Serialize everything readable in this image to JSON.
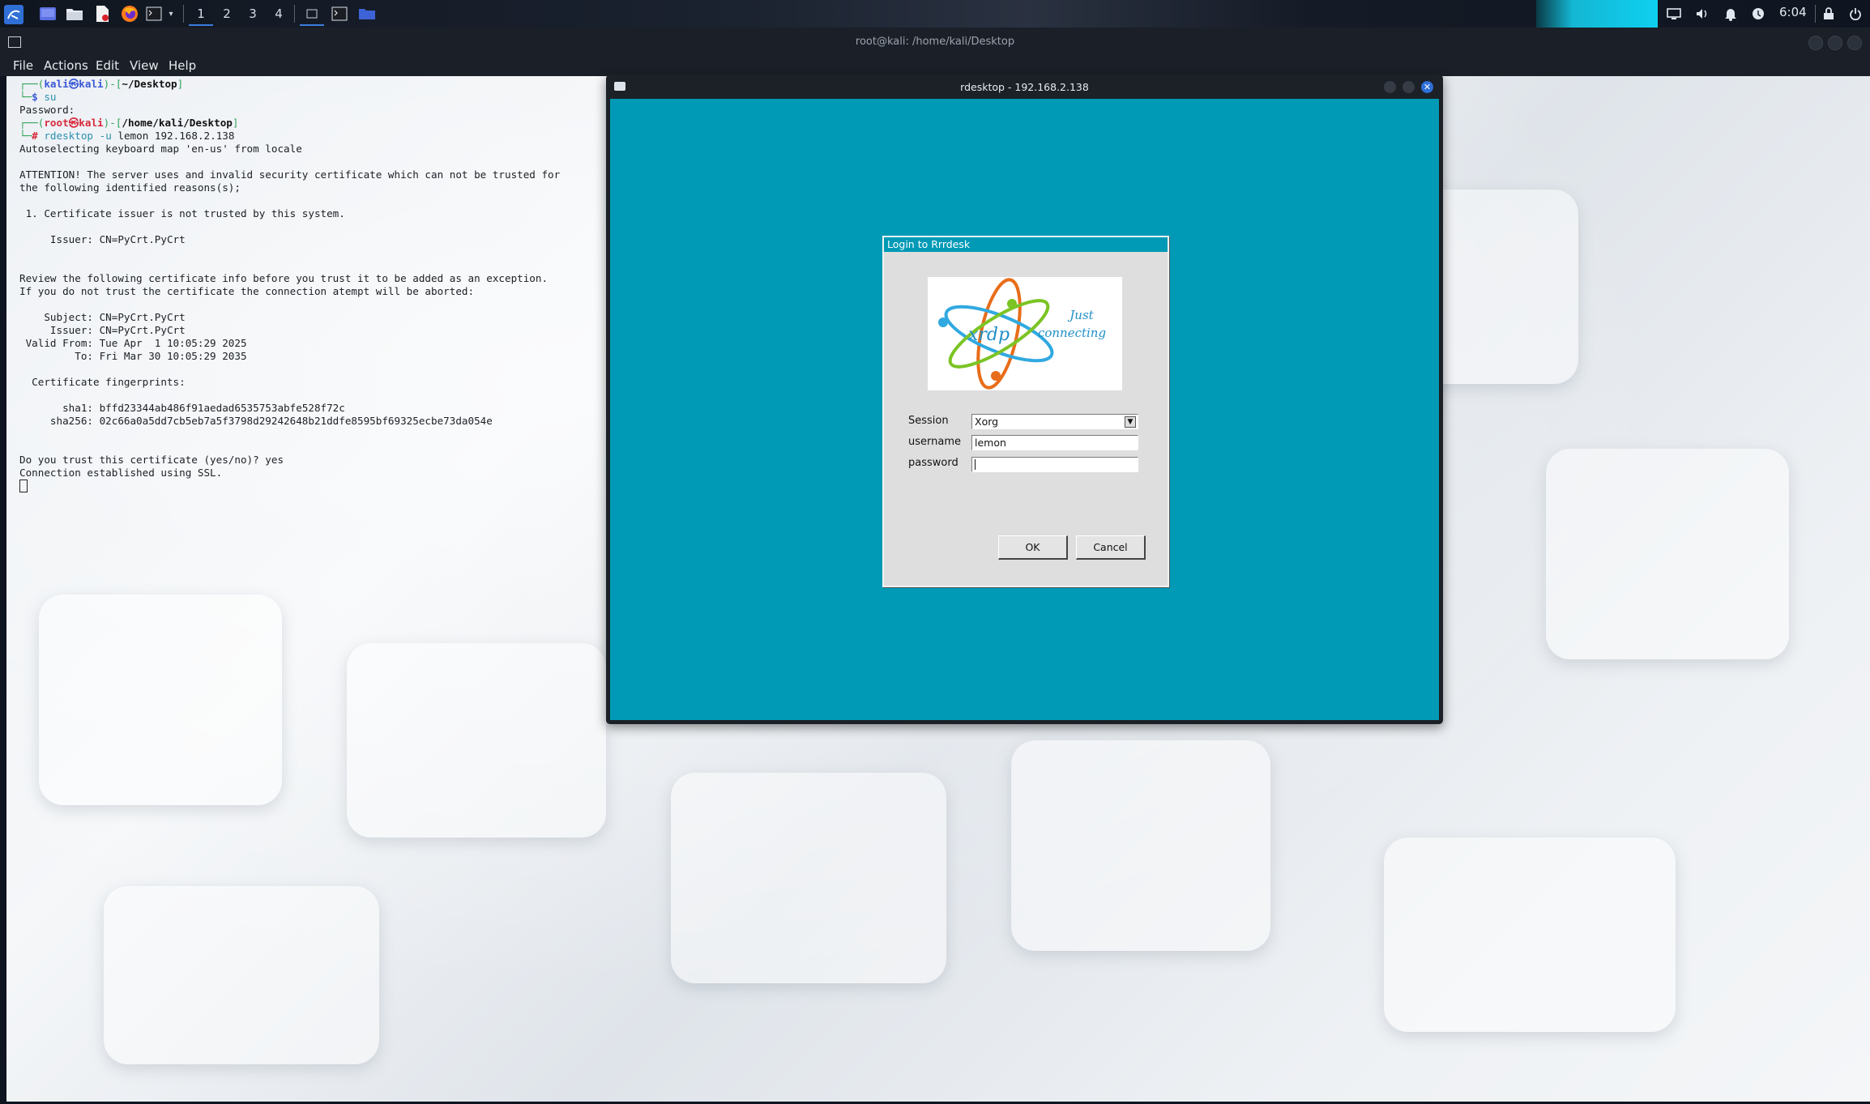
{
  "panel": {
    "workspaces": [
      "1",
      "2",
      "3",
      "4"
    ],
    "active_workspace": "1",
    "clock": "6:04",
    "icons": [
      "kali-menu-icon",
      "desktop-icon",
      "file-manager-icon",
      "text-editor-icon",
      "firefox-icon",
      "terminal-icon",
      "chevron-down-icon",
      "window-icon",
      "terminal-window-icon",
      "folder-icon",
      "display-icon",
      "volume-icon",
      "bell-icon",
      "update-icon",
      "lock-icon",
      "power-icon"
    ],
    "accent_color": "#3b7ddd",
    "graph_color": "#14b7d3"
  },
  "terminal": {
    "title": "root@kali: /home/kali/Desktop",
    "menu": [
      "File",
      "Actions",
      "Edit",
      "View",
      "Help"
    ],
    "prompt1": {
      "user": "kali",
      "host": "kali",
      "path": "~/Desktop",
      "cmd": "su"
    },
    "line_password": "Password:",
    "prompt2": {
      "user": "root",
      "host": "kali",
      "path": "/home/kali/Desktop",
      "cmd_name": "rdesktop",
      "cmd_flag": "-u",
      "cmd_args": "lemon 192.168.2.138"
    },
    "output": [
      "Autoselecting keyboard map 'en-us' from locale",
      "",
      "ATTENTION! The server uses and invalid security certificate which can not be trusted for",
      "the following identified reasons(s);",
      "",
      " 1. Certificate issuer is not trusted by this system.",
      "",
      "     Issuer: CN=PyCrt.PyCrt",
      "",
      "",
      "Review the following certificate info before you trust it to be added as an exception.",
      "If you do not trust the certificate the connection atempt will be aborted:",
      "",
      "    Subject: CN=PyCrt.PyCrt",
      "     Issuer: CN=PyCrt.PyCrt",
      " Valid From: Tue Apr  1 10:05:29 2025",
      "         To: Fri Mar 30 10:05:29 2035",
      "",
      "  Certificate fingerprints:",
      "",
      "       sha1: bffd23344ab486f91aedad6535753abfe528f72c",
      "     sha256: 02c66a0a5dd7cb5eb7a5f3798d29242648b21ddfe8595bf69325ecbe73da054e",
      "",
      "",
      "Do you trust this certificate (yes/no)? yes",
      "Connection established using SSL."
    ]
  },
  "rdesktop": {
    "title": "rdesktop - 192.168.2.138",
    "screen_color": "#009ab6"
  },
  "login_dialog": {
    "title": "Login to Rrrdesk",
    "logo_text": "xrdp",
    "tagline_line1": "Just",
    "tagline_line2": "connecting",
    "session_label": "Session",
    "session_value": "Xorg",
    "username_label": "username",
    "username_value": "lemon",
    "password_label": "password",
    "password_value": "",
    "ok_label": "OK",
    "cancel_label": "Cancel"
  }
}
